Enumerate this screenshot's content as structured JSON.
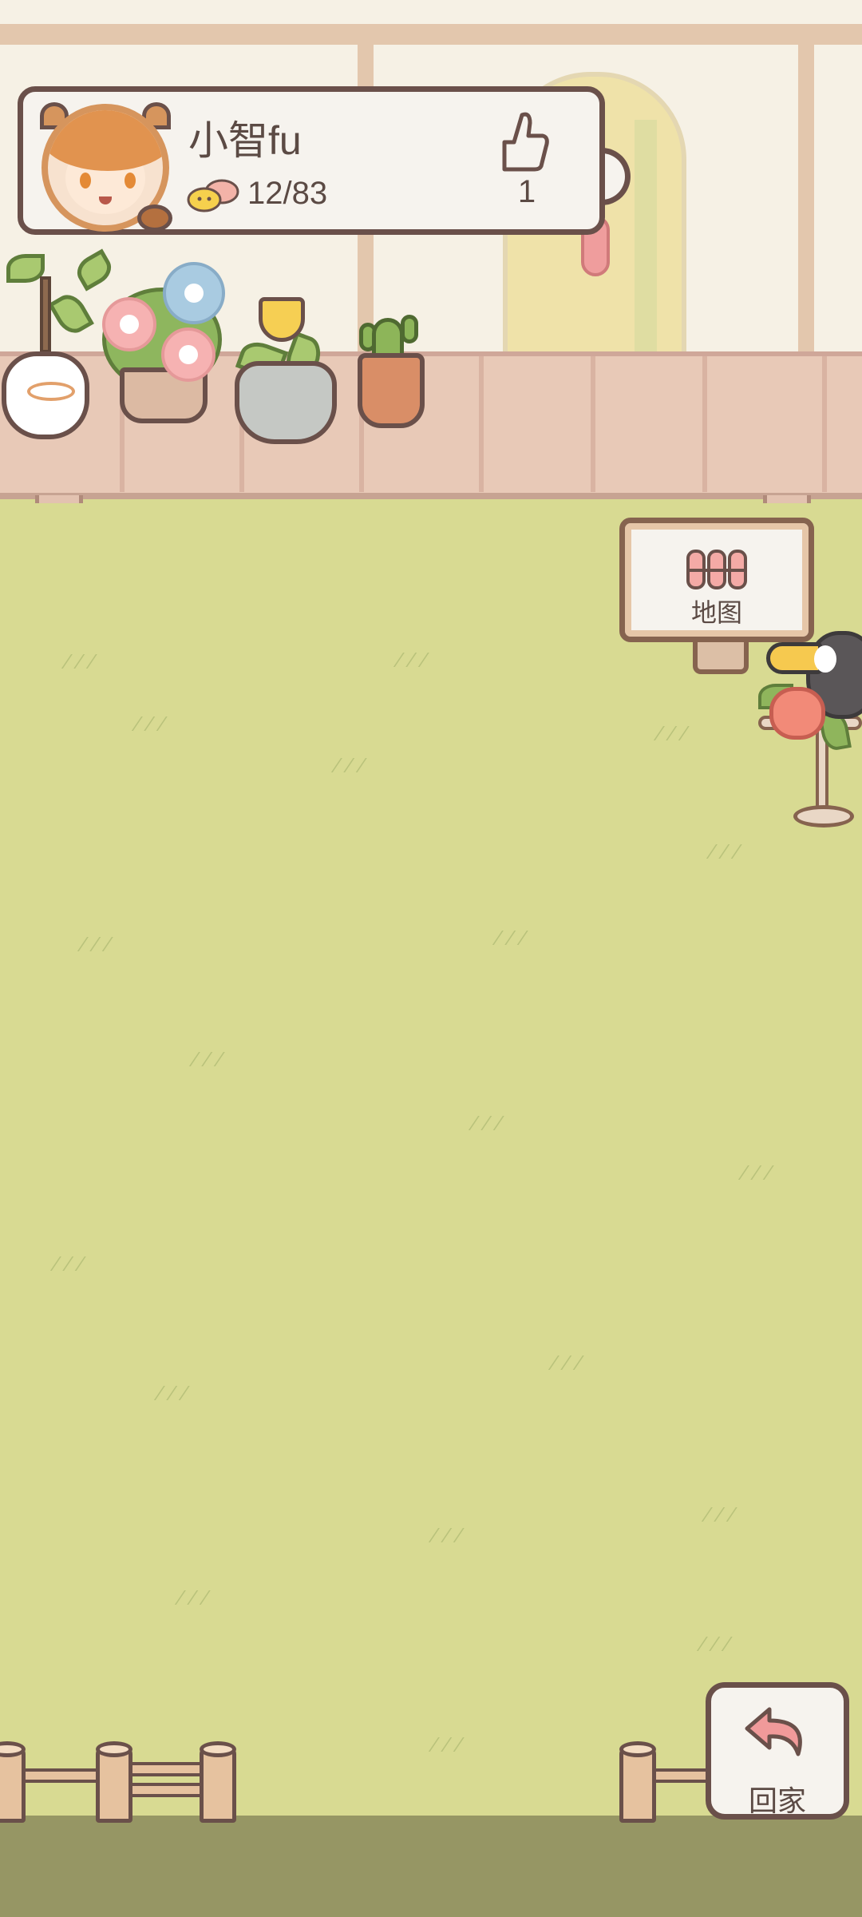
{
  "profile": {
    "username": "小智fu",
    "progress": "12/83",
    "likes": "1",
    "avatar_icon": "raccoon-kid-avatar-icon",
    "progress_icon": "critters-icon",
    "like_icon": "thumbs-up-icon"
  },
  "map_sign": {
    "label": "地图",
    "icon": "fence-map-icon"
  },
  "home_button": {
    "label": "回家",
    "icon": "return-arrow-icon"
  },
  "colors": {
    "lawn": "#d8da92",
    "ground": "#969664",
    "wall": "#f6f1e5",
    "fence": "#e8c9b7",
    "card_border": "#6a504a",
    "text": "#5b4a44",
    "accent_pink": "#f28a78"
  }
}
